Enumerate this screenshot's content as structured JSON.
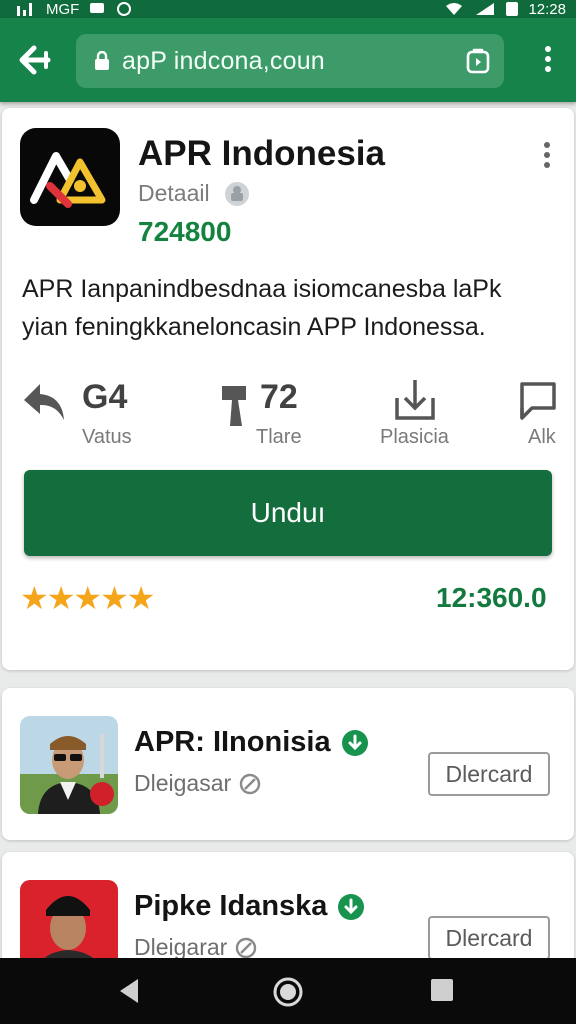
{
  "status_bar": {
    "left_text": "MGF",
    "time": "12:28"
  },
  "toolbar": {
    "url": "apP indcona,coun"
  },
  "app": {
    "title": "APR Indonesia",
    "subtitle": "Detaail",
    "id_number": "724800",
    "description": "APR Ianpanindbesdnaa isiomcanesba laPk yian feningkkanelоncasin APP Indonessa.",
    "stats": [
      {
        "value": "G4",
        "label": "Vatus",
        "icon": "share-icon"
      },
      {
        "value": "72",
        "label": "Tlare",
        "icon": "thumb-icon"
      },
      {
        "value": "",
        "label": "Plasicia",
        "icon": "download-icon"
      },
      {
        "value": "",
        "label": "Alk",
        "icon": "chat-icon"
      }
    ],
    "download_label": "Unduı",
    "rating_stars": 5,
    "rating_count": "12:360.0"
  },
  "list": [
    {
      "title": "APR: IInonisia",
      "subtitle": "Dleigasar",
      "button_label": "Dlercard",
      "verified": true
    },
    {
      "title": "Pipke Idanska",
      "subtitle": "Dleigarar",
      "button_label": "Dlercard",
      "verified": true
    }
  ],
  "colors": {
    "primary": "#15834a",
    "status_bar": "#0f6b3c",
    "button": "#136d3d",
    "accent_text": "#137a3f",
    "star": "#f4a51a"
  }
}
